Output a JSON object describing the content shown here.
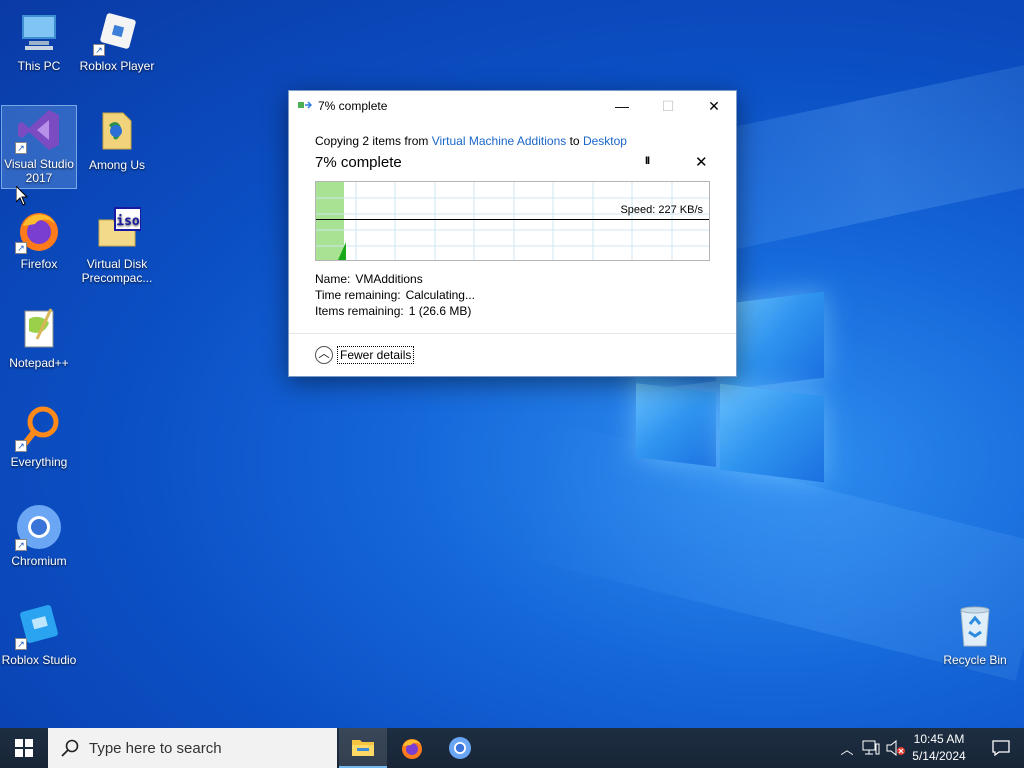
{
  "desktop": {
    "icons": [
      {
        "label": "This PC",
        "icon": "this-pc-icon"
      },
      {
        "label": "Roblox Player",
        "icon": "roblox-player-icon"
      },
      {
        "label": "Visual Studio 2017",
        "icon": "visual-studio-icon"
      },
      {
        "label": "Among Us",
        "icon": "folder-icon"
      },
      {
        "label": "Firefox",
        "icon": "firefox-icon"
      },
      {
        "label": "Virtual Disk Precompac...",
        "icon": "iso-disk-icon"
      },
      {
        "label": "Notepad++",
        "icon": "notepadpp-icon"
      },
      {
        "label": "Everything",
        "icon": "everything-search-icon"
      },
      {
        "label": "Chromium",
        "icon": "chromium-icon"
      },
      {
        "label": "Roblox Studio",
        "icon": "roblox-studio-icon"
      },
      {
        "label": "Recycle Bin",
        "icon": "recycle-bin-icon"
      }
    ]
  },
  "dialog": {
    "title": "7% complete",
    "copy_prefix": "Copying 2 items from ",
    "source": "Virtual Machine Additions",
    "to_word": " to ",
    "destination": "Desktop",
    "percent_heading": "7% complete",
    "progress_fraction": 0.07,
    "pause_label": "II",
    "stop_label": "✕",
    "speed_text": "Speed: 227 KB/s",
    "name_label": "Name:",
    "name_value": "VMAdditions",
    "time_label": "Time remaining:",
    "time_value": "Calculating...",
    "items_label": "Items remaining:",
    "items_value": "1 (26.6 MB)",
    "fewer_details": "Fewer details",
    "min_glyph": "—",
    "max_glyph": "☐",
    "close_glyph": "✕"
  },
  "taskbar": {
    "search_placeholder": "Type here to search",
    "apps": [
      "file-explorer-icon",
      "firefox-icon",
      "chromium-icon"
    ],
    "time": "10:45 AM",
    "date": "5/14/2024"
  },
  "colors": {
    "accent_link": "#1a66c8",
    "progress_fill": "#a8e293",
    "taskbar": "#1c2a3a"
  }
}
